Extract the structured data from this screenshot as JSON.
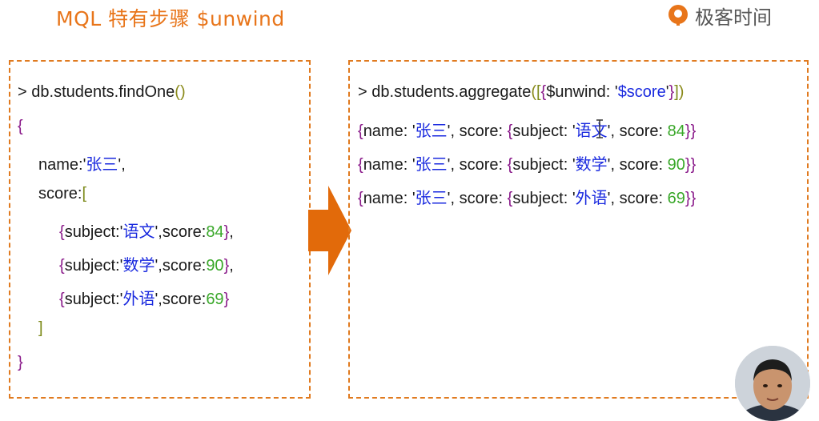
{
  "header": {
    "title": "MQL 特有步骤 $unwind",
    "logo_text": "极客时间",
    "brand_color": "#e8751a"
  },
  "left_panel": {
    "l1": {
      "prompt": "> ",
      "db": "db",
      "dot1": ".",
      "coll": "students",
      "dot2": ".",
      "fn": "findOne",
      "parens": "()"
    },
    "l2": {
      "brace": "{"
    },
    "l3": {
      "key": "name:",
      "q1": "'",
      "val": "张三",
      "q2": "'",
      "comma": ","
    },
    "l4": {
      "key": "score:",
      "bracket": "["
    },
    "items": [
      {
        "open": "{",
        "k1": "subject:",
        "q1": "'",
        "subject": "语文",
        "q2": "'",
        "sep": ",",
        "k2": "score:",
        "score": "84",
        "close": "}",
        "comma": ","
      },
      {
        "open": "{",
        "k1": "subject:",
        "q1": "'",
        "subject": "数学",
        "q2": "'",
        "sep": ",",
        "k2": "score:",
        "score": "90",
        "close": "}",
        "comma": ","
      },
      {
        "open": "{",
        "k1": "subject:",
        "q1": "'",
        "subject": "外语",
        "q2": "'",
        "sep": ",",
        "k2": "score:",
        "score": "69",
        "close": "}",
        "comma": ""
      }
    ],
    "l8": {
      "bracket": "]"
    },
    "l9": {
      "brace": "}"
    }
  },
  "right_panel": {
    "cmd": {
      "prompt": "> ",
      "db": "db",
      "dot1": ".",
      "coll": "students",
      "dot2": ".",
      "fn": "aggregate",
      "open_paren": "(",
      "open_bracket": "[",
      "open_brace": "{",
      "key": "$unwind: ",
      "q1": "'",
      "val": "$score",
      "q2": "'",
      "close_brace": "}",
      "close_bracket": "]",
      "close_paren": ")"
    },
    "results": [
      {
        "open": "{",
        "k1": "name: ",
        "q1": "'",
        "name": "张三",
        "q2": "'",
        "sep1": ", ",
        "k2": "score: ",
        "open2": "{",
        "k3": "subject: ",
        "q3": "'",
        "subject": "语文",
        "q4": "'",
        "sep2": ", ",
        "k4": "score: ",
        "score": "84",
        "close2": "}",
        "close": "}"
      },
      {
        "open": "{",
        "k1": "name: ",
        "q1": "'",
        "name": "张三",
        "q2": "'",
        "sep1": ", ",
        "k2": "score: ",
        "open2": "{",
        "k3": "subject: ",
        "q3": "'",
        "subject": "数学",
        "q4": "'",
        "sep2": ", ",
        "k4": "score: ",
        "score": "90",
        "close2": "}",
        "close": "}"
      },
      {
        "open": "{",
        "k1": "name: ",
        "q1": "'",
        "name": "张三",
        "q2": "'",
        "sep1": ", ",
        "k2": "score: ",
        "open2": "{",
        "k3": "subject: ",
        "q3": "'",
        "subject": "外语",
        "q4": "'",
        "sep2": ", ",
        "k4": "score: ",
        "score": "69",
        "close2": "}",
        "close": "}"
      }
    ]
  },
  "colors": {
    "accent_orange": "#e07a1f",
    "string_blue": "#1a2adf",
    "number_green": "#3aa82a",
    "brace_purple": "#8a1a8a"
  }
}
